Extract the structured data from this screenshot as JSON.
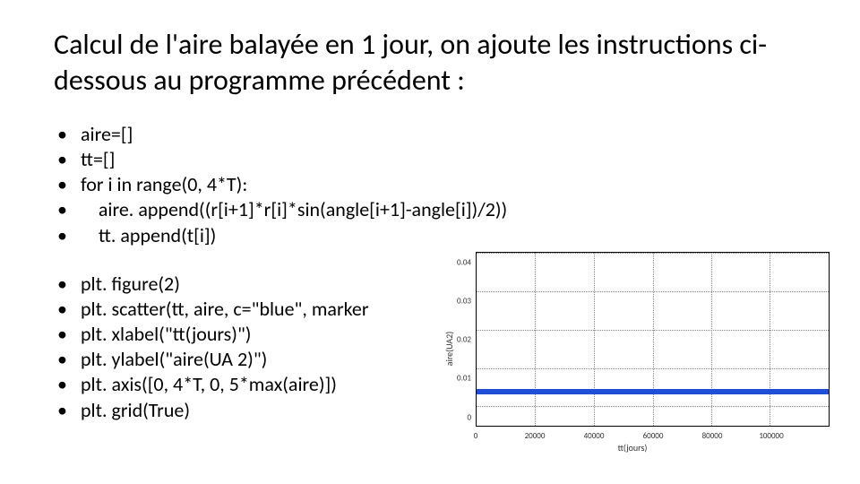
{
  "title": "Calcul de l'aire balayée en 1 jour, on ajoute les instructions ci-dessous au programme précédent :",
  "code": {
    "block1": [
      "aire=[]",
      "tt=[]",
      "for i in range(0, 4*T):",
      "    aire. append((r[i+1]*r[i]*sin(angle[i+1]-angle[i])/2))",
      "    tt. append(t[i])"
    ],
    "block2": [
      "plt. figure(2)",
      "plt. scatter(tt, aire, c=\"blue\", marker",
      "plt. xlabel(\"tt(jours)\")",
      "plt. ylabel(\"aire(UA 2)\")",
      "plt. axis([0, 4*T, 0, 5*max(aire)])",
      "plt. grid(True)"
    ]
  },
  "chart_data": {
    "type": "scatter",
    "xlabel": "tt(jours)",
    "ylabel": "aire(UA2)",
    "xlim": [
      0,
      120000
    ],
    "ylim": [
      0,
      0.045
    ],
    "yticks": [
      0.0,
      0.01,
      0.02,
      0.03,
      0.04
    ],
    "xticks": [
      0,
      20000,
      40000,
      60000,
      80000,
      100000
    ],
    "approx_constant_value": 0.009,
    "note": "scatter appears as a nearly constant horizontal band around y≈0.009 across the full x range"
  }
}
